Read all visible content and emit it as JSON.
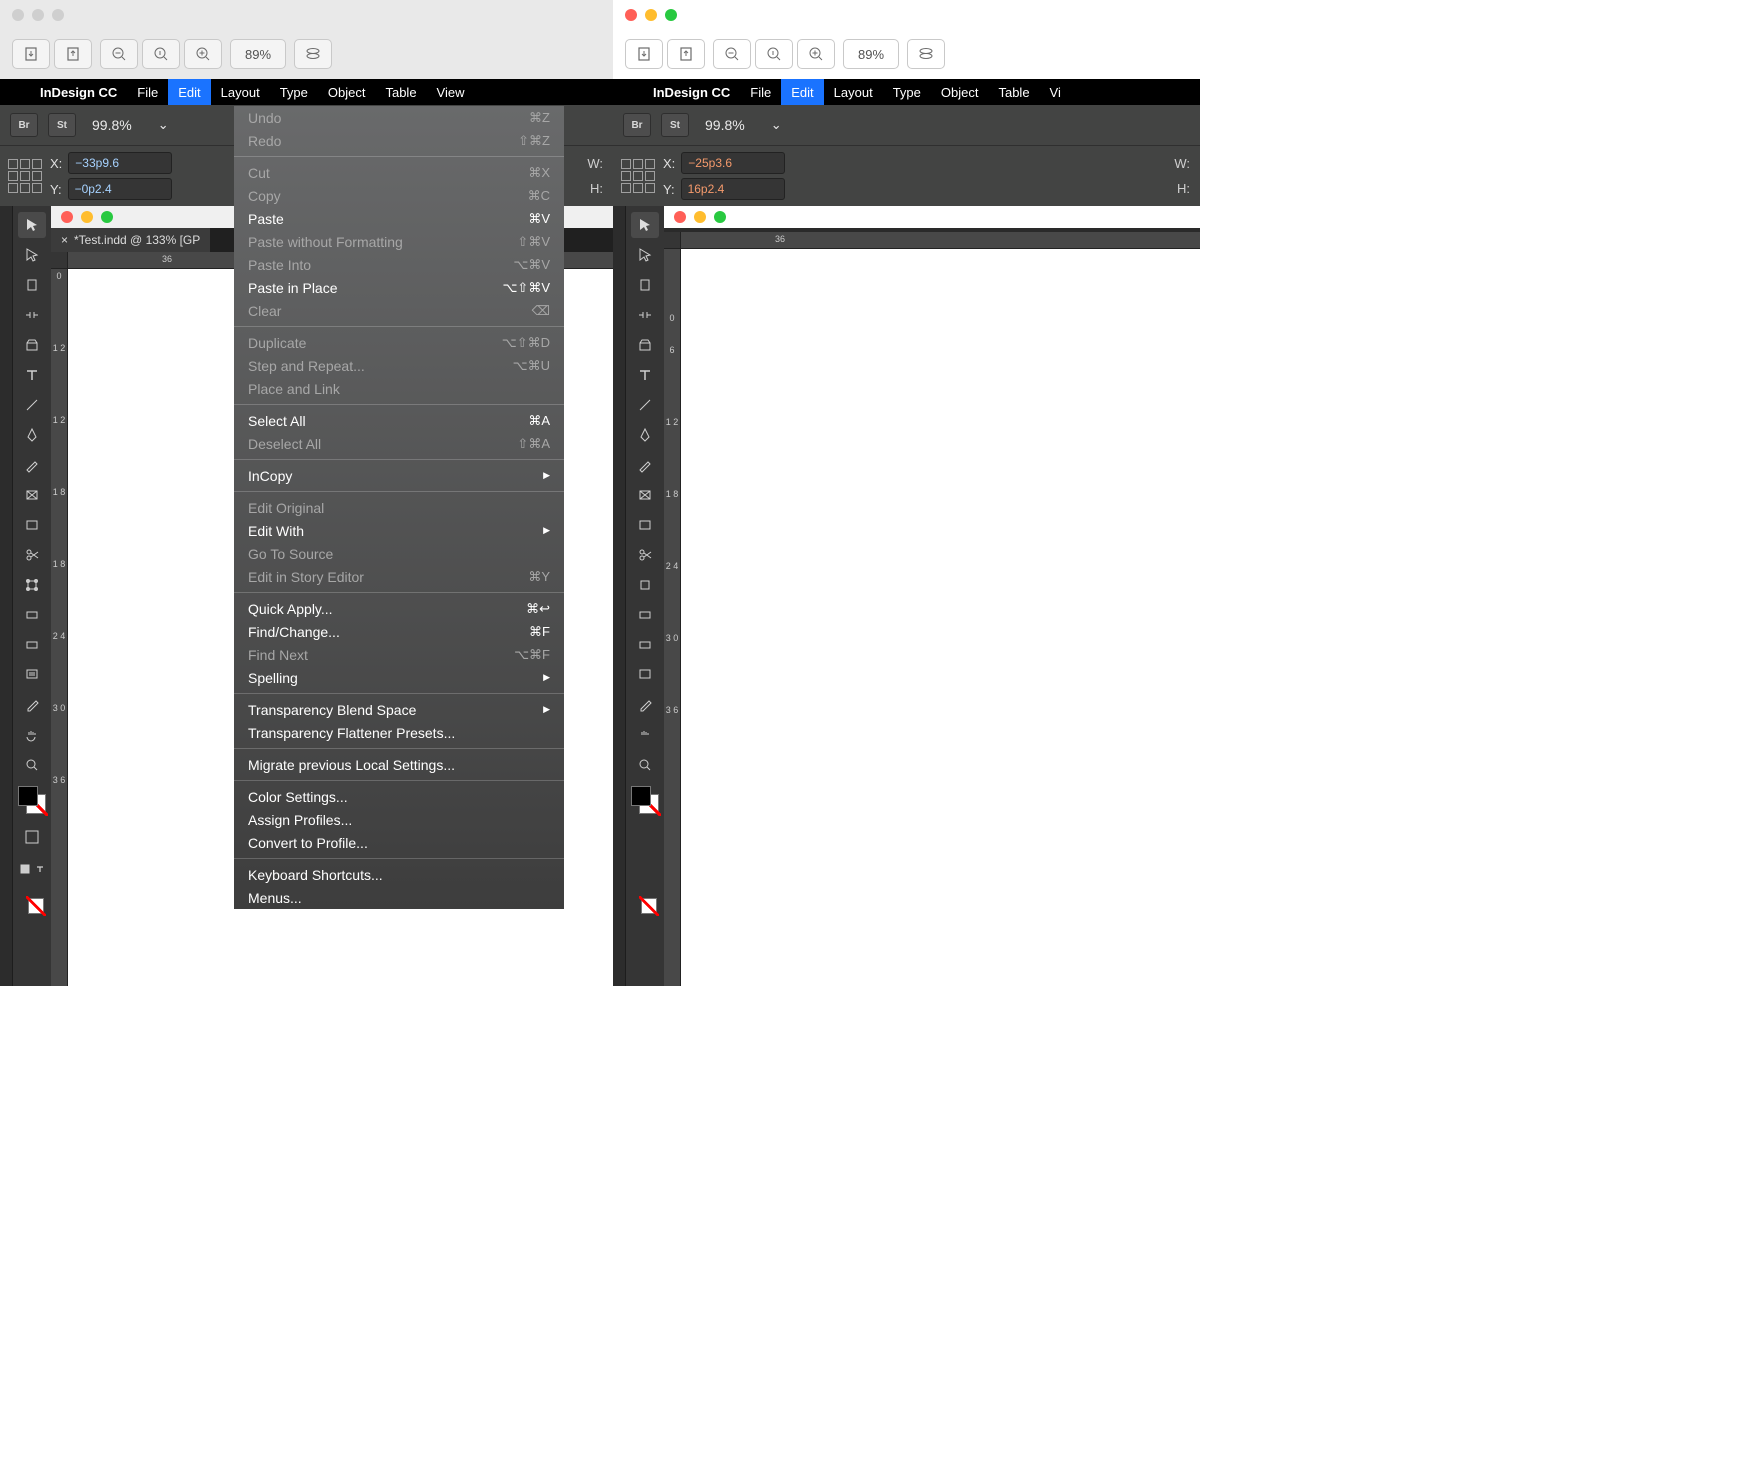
{
  "app_name": "InDesign CC",
  "menus": [
    "File",
    "Edit",
    "Layout",
    "Type",
    "Object",
    "Table",
    "View"
  ],
  "menus_b_lastcut": "Vi",
  "toolbar_zoom": "89%",
  "controlstrip": {
    "br": "Br",
    "st": "St",
    "zoom": "99.8%"
  },
  "coords_a": {
    "x_label": "X:",
    "y_label": "Y:",
    "x": "−33p9.6",
    "y": "−0p2.4",
    "w": "W:",
    "h": "H:"
  },
  "coords_b": {
    "x_label": "X:",
    "y_label": "Y:",
    "x": "−25p3.6",
    "y": "16p2.4",
    "w": "W:",
    "h": "H:"
  },
  "a_doc_tab": "*Test.indd @ 133% [GP",
  "hrule_a": "36",
  "hrule_b": "36",
  "vrule": [
    "0",
    "1\n2",
    "1\n2",
    "1\n8",
    "1\n8",
    "2\n4",
    "3\n0",
    "3\n6"
  ],
  "edit_menu": [
    {
      "label": "Undo",
      "shortcut": "⌘Z",
      "dim": true
    },
    {
      "label": "Redo",
      "shortcut": "⇧⌘Z",
      "dim": true
    },
    {
      "type": "sep"
    },
    {
      "label": "Cut",
      "shortcut": "⌘X",
      "dim": true
    },
    {
      "label": "Copy",
      "shortcut": "⌘C",
      "dim": true
    },
    {
      "label": "Paste",
      "shortcut": "⌘V"
    },
    {
      "label": "Paste without Formatting",
      "shortcut": "⇧⌘V",
      "dim": true
    },
    {
      "label": "Paste Into",
      "shortcut": "⌥⌘V",
      "dim": true
    },
    {
      "label": "Paste in Place",
      "shortcut": "⌥⇧⌘V"
    },
    {
      "label": "Clear",
      "shortcut": "⌫",
      "dim": true
    },
    {
      "type": "sep"
    },
    {
      "label": "Duplicate",
      "shortcut": "⌥⇧⌘D",
      "dim": true
    },
    {
      "label": "Step and Repeat...",
      "shortcut": "⌥⌘U",
      "dim": true
    },
    {
      "label": "Place and Link",
      "dim": true
    },
    {
      "type": "sep"
    },
    {
      "label": "Select All",
      "shortcut": "⌘A"
    },
    {
      "label": "Deselect All",
      "shortcut": "⇧⌘A",
      "dim": true
    },
    {
      "type": "sep"
    },
    {
      "label": "InCopy",
      "arrow": true
    },
    {
      "type": "sep"
    },
    {
      "label": "Edit Original",
      "dim": true
    },
    {
      "label": "Edit With",
      "arrow": true
    },
    {
      "label": "Go To Source",
      "dim": true
    },
    {
      "label": "Edit in Story Editor",
      "shortcut": "⌘Y",
      "dim": true
    },
    {
      "type": "sep"
    },
    {
      "label": "Quick Apply...",
      "shortcut": "⌘↩"
    },
    {
      "label": "Find/Change...",
      "shortcut": "⌘F"
    },
    {
      "label": "Find Next",
      "shortcut": "⌥⌘F",
      "dim": true
    },
    {
      "label": "Spelling",
      "arrow": true
    },
    {
      "type": "sep"
    },
    {
      "label": "Transparency Blend Space",
      "arrow": true
    },
    {
      "label": "Transparency Flattener Presets..."
    },
    {
      "type": "sep"
    },
    {
      "label": "Migrate previous Local Settings..."
    },
    {
      "type": "sep"
    },
    {
      "label": "Color Settings..."
    },
    {
      "label": "Assign Profiles..."
    },
    {
      "label": "Convert to Profile..."
    },
    {
      "type": "sep"
    },
    {
      "label": "Keyboard Shortcuts..."
    },
    {
      "label": "Menus..."
    }
  ]
}
